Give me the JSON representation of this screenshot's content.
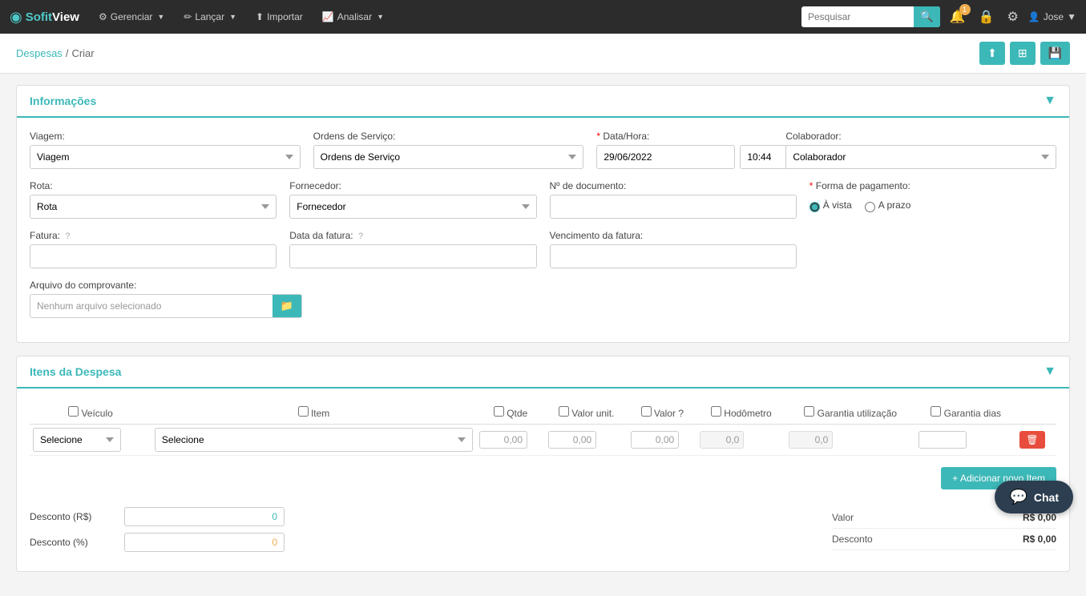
{
  "brand": {
    "sofit": "Sofit",
    "view": "View"
  },
  "navbar": {
    "items": [
      {
        "label": "Gerenciar",
        "has_dropdown": true,
        "icon": "⚙"
      },
      {
        "label": "Lançar",
        "has_dropdown": true,
        "icon": "✏"
      },
      {
        "label": "Importar",
        "has_dropdown": false,
        "icon": "⬆"
      },
      {
        "label": "Analisar",
        "has_dropdown": true,
        "icon": "📈"
      }
    ],
    "search_placeholder": "Pesquisar",
    "notification_count": "1",
    "user_label": "Jose"
  },
  "breadcrumb": {
    "parent_label": "Despesas",
    "current_label": "Criar"
  },
  "toolbar": {
    "upload_icon": "⬆",
    "table_icon": "⊞",
    "save_icon": "💾"
  },
  "informacoes_section": {
    "title": "Informações",
    "fields": {
      "viagem_label": "Viagem:",
      "viagem_placeholder": "Viagem",
      "ordens_label": "Ordens de Serviço:",
      "ordens_placeholder": "Ordens de Serviço",
      "data_hora_label": "Data/Hora:",
      "data_hora_required": true,
      "data_value": "29/06/2022",
      "hora_value": "10:44",
      "colaborador_label": "Colaborador:",
      "colaborador_placeholder": "Colaborador",
      "rota_label": "Rota:",
      "rota_placeholder": "Rota",
      "fornecedor_label": "Fornecedor:",
      "fornecedor_placeholder": "Fornecedor",
      "ndoc_label": "Nº de documento:",
      "forma_pagamento_label": "Forma de pagamento:",
      "forma_pagamento_required": true,
      "radio_avista": "À vista",
      "radio_aprazo": "A prazo",
      "fatura_label": "Fatura:",
      "data_fatura_label": "Data da fatura:",
      "vencimento_label": "Vencimento da fatura:",
      "arquivo_label": "Arquivo do comprovante:",
      "arquivo_placeholder": "Nenhum arquivo selecionado"
    }
  },
  "itens_section": {
    "title": "Itens da Despesa",
    "columns": {
      "veiculo": "Veículo",
      "item": "Item",
      "qtde": "Qtde",
      "valor_unit": "Valor unit.",
      "valor": "Valor",
      "hodometro": "Hodômetro",
      "garantia_utilizacao": "Garantia utilização",
      "garantia_dias": "Garantia dias"
    },
    "row": {
      "veiculo_placeholder": "Selecione",
      "item_placeholder": "Selecione",
      "qtde_value": "0,00",
      "valor_unit_value": "0,00",
      "valor_value": "0,00",
      "hodometro_value": "0,0",
      "garantia_util_value": "0,0",
      "garantia_dias_value": ""
    },
    "add_button": "+ Adicionar novo Item"
  },
  "totals": {
    "desconto_rs_label": "Desconto (R$)",
    "desconto_rs_value": "0",
    "desconto_pct_label": "Desconto (%)",
    "desconto_pct_value": "0",
    "valor_label": "Valor",
    "valor_value": "R$ 0,00",
    "desconto_label": "Desconto",
    "desconto_value": "R$ 0,00"
  },
  "chat": {
    "label": "Chat"
  }
}
